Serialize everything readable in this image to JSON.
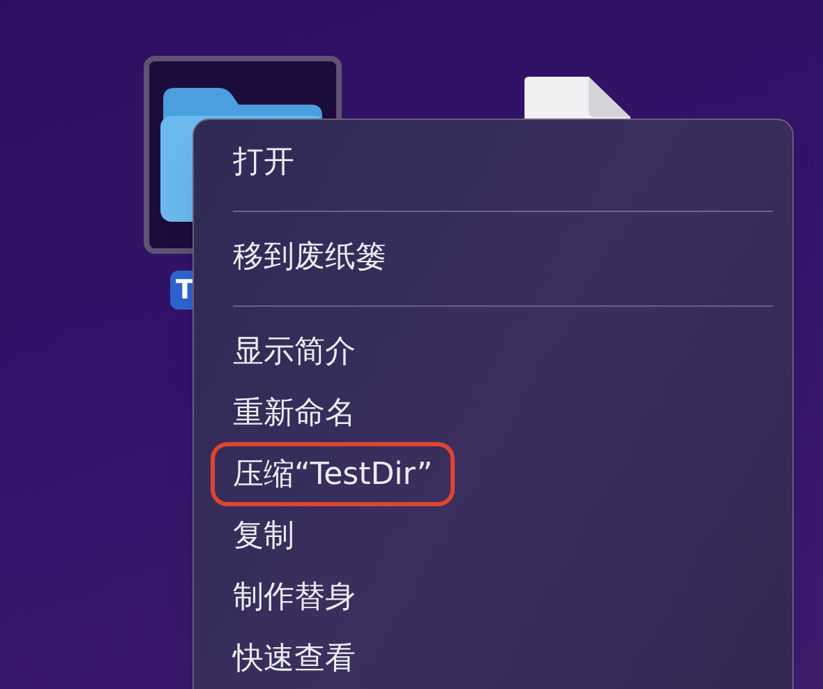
{
  "desktop_icons": [
    {
      "kind": "folder",
      "selected": true,
      "label": "T"
    },
    {
      "kind": "document",
      "selected": false
    }
  ],
  "context_menu": {
    "groups": [
      [
        {
          "label": "打开",
          "annotated": false
        }
      ],
      [
        {
          "label": "移到废纸篓",
          "annotated": false
        }
      ],
      [
        {
          "label": "显示简介",
          "annotated": false
        },
        {
          "label": "重新命名",
          "annotated": false
        },
        {
          "label": "压缩“TestDir”",
          "annotated": true
        },
        {
          "label": "复制",
          "annotated": false
        },
        {
          "label": "制作替身",
          "annotated": false
        },
        {
          "label": "快速查看",
          "annotated": false
        }
      ]
    ]
  }
}
